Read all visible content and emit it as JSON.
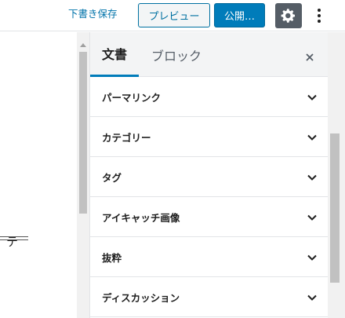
{
  "toolbar": {
    "save_draft": "下書き保存",
    "preview": "プレビュー",
    "publish": "公開…",
    "settings_icon": "gear-icon",
    "more_icon": "vertical-ellipsis-icon"
  },
  "editor": {
    "visible_text": "テ"
  },
  "sidebar": {
    "tabs": [
      {
        "label": "文書",
        "active": true
      },
      {
        "label": "ブロック",
        "active": false
      }
    ],
    "close_label": "×",
    "panels": [
      {
        "label": "パーマリンク"
      },
      {
        "label": "カテゴリー"
      },
      {
        "label": "タグ"
      },
      {
        "label": "アイキャッチ画像"
      },
      {
        "label": "抜粋"
      },
      {
        "label": "ディスカッション"
      }
    ]
  },
  "colors": {
    "accent": "#007cba",
    "settings_bg": "#555d66"
  }
}
